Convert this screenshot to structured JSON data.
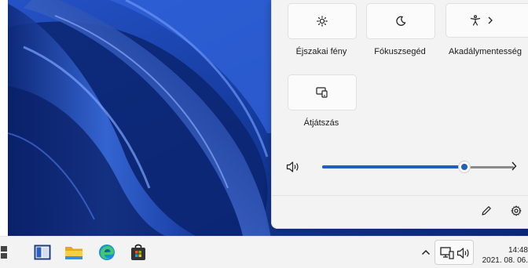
{
  "quick_settings": {
    "tiles": [
      {
        "label": "Éjszakai fény",
        "icon": "night-light-icon"
      },
      {
        "label": "Fókuszsegéd",
        "icon": "focus-assist-icon"
      },
      {
        "label": "Akadálymentesség",
        "icon": "accessibility-icon"
      }
    ],
    "cast_label": "Átjátszás",
    "volume": {
      "level": 0.74,
      "icon": "speaker-icon"
    }
  },
  "taskbar": {
    "clock_time": "14:48",
    "clock_date": "2021. 08. 06."
  },
  "colors": {
    "accent": "#1f5fbf",
    "wallpaper": "#1b3fa8"
  }
}
